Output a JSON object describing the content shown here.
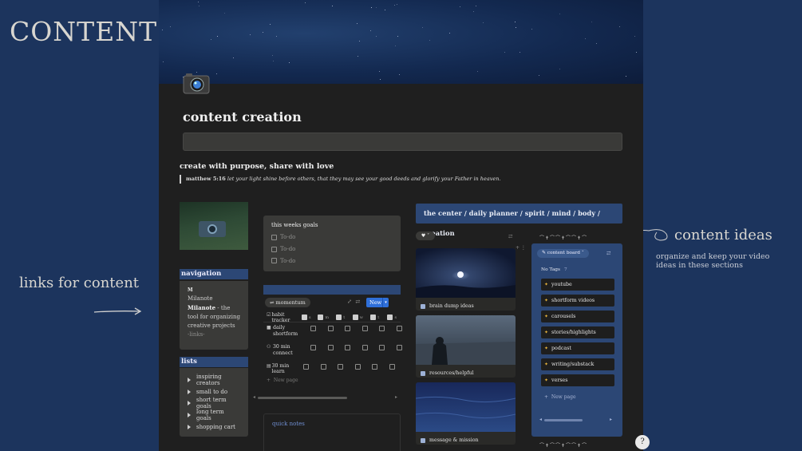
{
  "left_panel": {
    "title": "CONTENT",
    "links_label": "links for content"
  },
  "right_panel": {
    "ideas_label": "content ideas",
    "ideas_sub": "organize and keep your video ideas in these sections"
  },
  "page": {
    "title": "content creation",
    "subtitle": "create with purpose, share with love",
    "quote_ref": "matthew 5:16",
    "quote_text": "let your light shine before others, that they may see your good deeds and glorify your Father in heaven."
  },
  "navigation": {
    "heading": "navigation",
    "icon_letter": "M",
    "link_name": "Milanote",
    "link_bold": "Milanote",
    "link_desc": "- the tool for organizing creative projects",
    "extra": "-links-"
  },
  "lists": {
    "heading": "lists",
    "items": [
      "inspiring creators",
      "small to do",
      "short term goals",
      "long term goals",
      "shopping cart"
    ]
  },
  "goals": {
    "heading": "this weeks goals",
    "todos": [
      "To-do",
      "To-do",
      "To-do"
    ]
  },
  "habit": {
    "view_chip": "momentum",
    "new_label": "New",
    "column_name": "habit tracker",
    "days": [
      "s",
      "m",
      "t",
      "w",
      "t",
      "s"
    ],
    "rows": [
      {
        "name": "daily shortform",
        "icon": "video-icon",
        "checks": [
          false,
          false,
          false,
          false,
          false,
          false
        ]
      },
      {
        "name": "30 min connect",
        "icon": "people-icon",
        "checks": [
          false,
          false,
          false,
          false,
          false,
          false
        ]
      },
      {
        "name": "30 min learn",
        "icon": "book-icon",
        "checks": [
          false,
          false,
          false,
          false,
          false,
          false
        ]
      }
    ],
    "new_page": "New page"
  },
  "notes": {
    "label": "quick notes"
  },
  "breadcrumb": "the center / daily planner / spirit / mind / body / creation",
  "gallery": {
    "chip": "♥",
    "cards": [
      {
        "caption": "brain dump ideas"
      },
      {
        "caption": "resources/helpful"
      },
      {
        "caption": "message & mission"
      }
    ]
  },
  "board": {
    "chip": "content board",
    "no_tags": "No Tags",
    "count": "7",
    "items": [
      "youtube",
      "shortform videos",
      "carousels",
      "stories/highlights",
      "podcast",
      "writing/substack",
      "verses"
    ],
    "new_page": "New page"
  },
  "colors": {
    "background": "#1c345d",
    "page": "#1f1f1f",
    "accent_blue": "#2c4775",
    "new_button": "#2f6fd8"
  }
}
